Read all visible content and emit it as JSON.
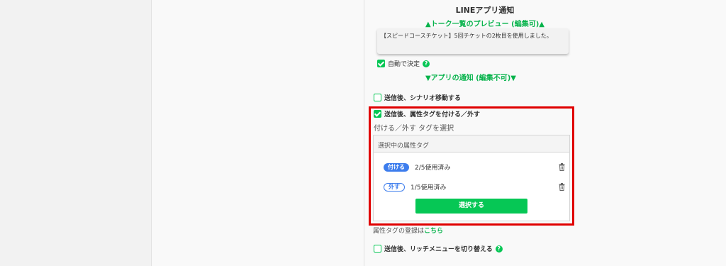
{
  "line_notification": {
    "title": "LINEアプリ通知",
    "preview_link": "▲トーク一覧のプレビュー (編集可)▲",
    "preview_text": "【スピードコースチケット】5回チケットの2枚目を使用しました。",
    "auto_decide_label": "自動で決定",
    "app_notification_link": "▼アプリの通知 (編集不可)▼"
  },
  "options": {
    "scenario_move": {
      "label": "送信後、シナリオ移動する",
      "checked": false
    },
    "attribute_tag": {
      "label": "送信後、属性タグを付ける／外す",
      "checked": true
    },
    "rich_menu": {
      "label": "送信後、リッチメニューを切り替える",
      "checked": false
    }
  },
  "tag_selector": {
    "label": "付ける／外す タグを選択",
    "panel_header": "選択中の属性タグ",
    "items": [
      {
        "badge": "付ける",
        "usage": "2/5使用済み"
      },
      {
        "badge": "外す",
        "usage": "1/5使用済み"
      }
    ],
    "select_button": "選択する"
  },
  "register": {
    "text": "属性タグの登録は",
    "link": "こちら"
  },
  "colors": {
    "accent_green": "#06c755",
    "tag_blue": "#3d7ded",
    "highlight_red": "#e00000"
  }
}
